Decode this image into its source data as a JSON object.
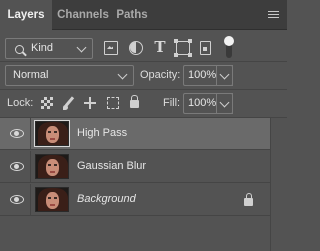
{
  "tabs": [
    {
      "label": "Layers",
      "active": true
    },
    {
      "label": "Channels",
      "active": false
    },
    {
      "label": "Paths",
      "active": false
    }
  ],
  "filter": {
    "kind_label": "Kind",
    "icons": [
      "pixel-layer-filter-icon",
      "adjustment-layer-filter-icon",
      "type-layer-filter-icon",
      "shape-layer-filter-icon",
      "smart-object-filter-icon"
    ]
  },
  "blend": {
    "mode": "Normal",
    "opacity_label": "Opacity:",
    "opacity_value": "100%"
  },
  "lock": {
    "label": "Lock:",
    "fill_label": "Fill:",
    "fill_value": "100%"
  },
  "layers": [
    {
      "name": "High Pass",
      "selected": true,
      "visible": true,
      "locked": false
    },
    {
      "name": "Gaussian Blur",
      "selected": false,
      "visible": true,
      "locked": false
    },
    {
      "name": "Background",
      "selected": false,
      "visible": true,
      "locked": true
    }
  ],
  "colors": {
    "panel_bg": "#535353",
    "tab_bar_bg": "#3d3d3d",
    "selected_row_bg": "#6a6a6a"
  }
}
